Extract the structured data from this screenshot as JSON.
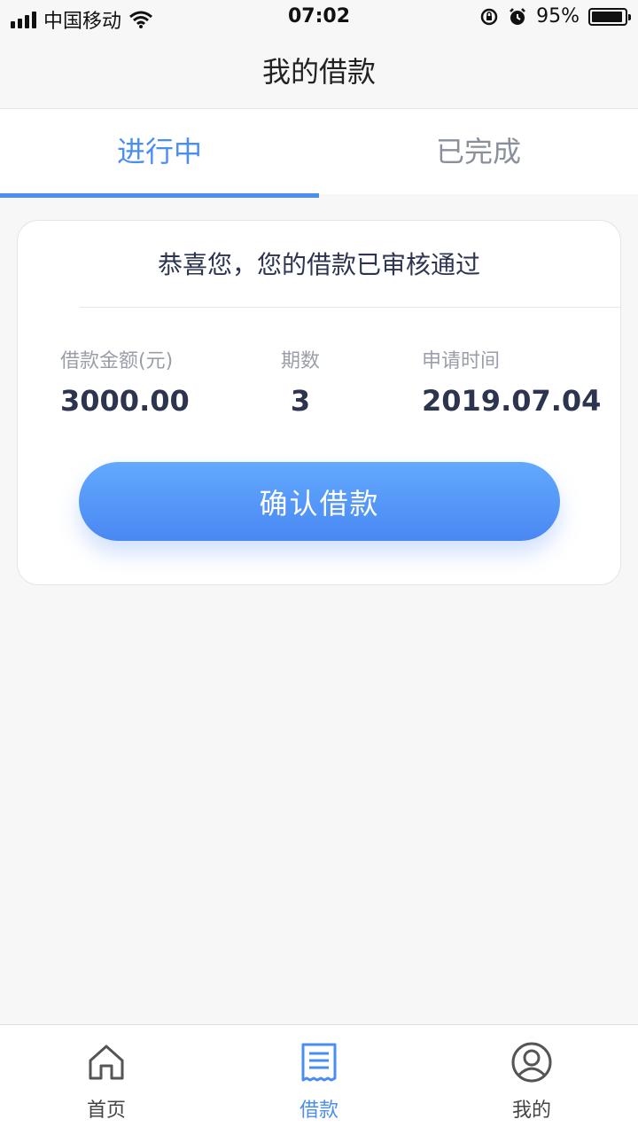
{
  "status_bar": {
    "carrier": "中国移动",
    "time": "07:02",
    "battery_percent": "95%",
    "battery_level": 0.95,
    "icons": [
      "signal-icon",
      "wifi-icon",
      "rotation-lock-icon",
      "alarm-icon",
      "battery-icon"
    ]
  },
  "header": {
    "title": "我的借款"
  },
  "tabs": [
    {
      "label": "进行中",
      "active": true
    },
    {
      "label": "已完成",
      "active": false
    }
  ],
  "loan_card": {
    "title": "恭喜您，您的借款已审核通过",
    "amount_label": "借款金额(元)",
    "amount_value": "3000.00",
    "periods_label": "期数",
    "periods_value": "3",
    "date_label": "申请时间",
    "date_value": "2019.07.04",
    "confirm_label": "确认借款"
  },
  "bottom_nav": {
    "items": [
      {
        "label": "首页",
        "icon": "home-icon",
        "active": false
      },
      {
        "label": "借款",
        "icon": "receipt-icon",
        "active": true
      },
      {
        "label": "我的",
        "icon": "user-icon",
        "active": false
      }
    ]
  },
  "colors": {
    "accent": "#4a8ef2",
    "text_dark": "#2d3450",
    "muted": "#9a9ea9"
  }
}
